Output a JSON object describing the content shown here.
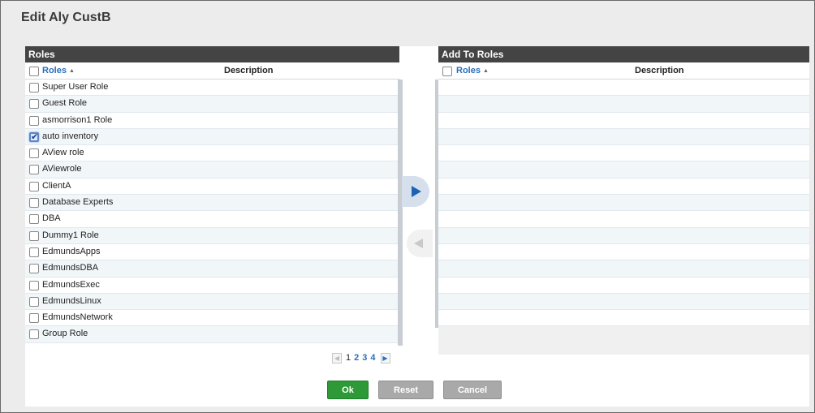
{
  "dialog": {
    "title": "Edit Aly CustB"
  },
  "left_panel": {
    "header": "Roles",
    "col_roles": "Roles",
    "col_description": "Description",
    "rows": [
      {
        "label": "Super User Role",
        "checked": false
      },
      {
        "label": "Guest Role",
        "checked": false
      },
      {
        "label": "asmorrison1 Role",
        "checked": false
      },
      {
        "label": "auto inventory",
        "checked": true
      },
      {
        "label": "AView role",
        "checked": false
      },
      {
        "label": "AViewrole",
        "checked": false
      },
      {
        "label": "ClientA",
        "checked": false
      },
      {
        "label": "Database Experts",
        "checked": false
      },
      {
        "label": "DBA",
        "checked": false
      },
      {
        "label": "Dummy1 Role",
        "checked": false
      },
      {
        "label": "EdmundsApps",
        "checked": false
      },
      {
        "label": "EdmundsDBA",
        "checked": false
      },
      {
        "label": "EdmundsExec",
        "checked": false
      },
      {
        "label": "EdmundsLinux",
        "checked": false
      },
      {
        "label": "EdmundsNetwork",
        "checked": false
      },
      {
        "label": "Group Role",
        "checked": false
      }
    ]
  },
  "pagination": {
    "pages": [
      "1",
      "2",
      "3",
      "4"
    ],
    "current": "1",
    "prev_icon": "prev-page-icon",
    "next_icon": "next-page-icon"
  },
  "transfer": {
    "add_icon": "arrow-right-icon",
    "remove_icon": "arrow-left-icon"
  },
  "right_panel": {
    "header": "Add To Roles",
    "col_roles": "Roles",
    "col_description": "Description",
    "empty_rows": 15
  },
  "buttons": {
    "ok": "Ok",
    "reset": "Reset",
    "cancel": "Cancel"
  },
  "colors": {
    "header_bg": "#444444",
    "link": "#2a6ebb",
    "ok_green": "#2d9a37",
    "secondary_gray": "#a9a9a9"
  }
}
